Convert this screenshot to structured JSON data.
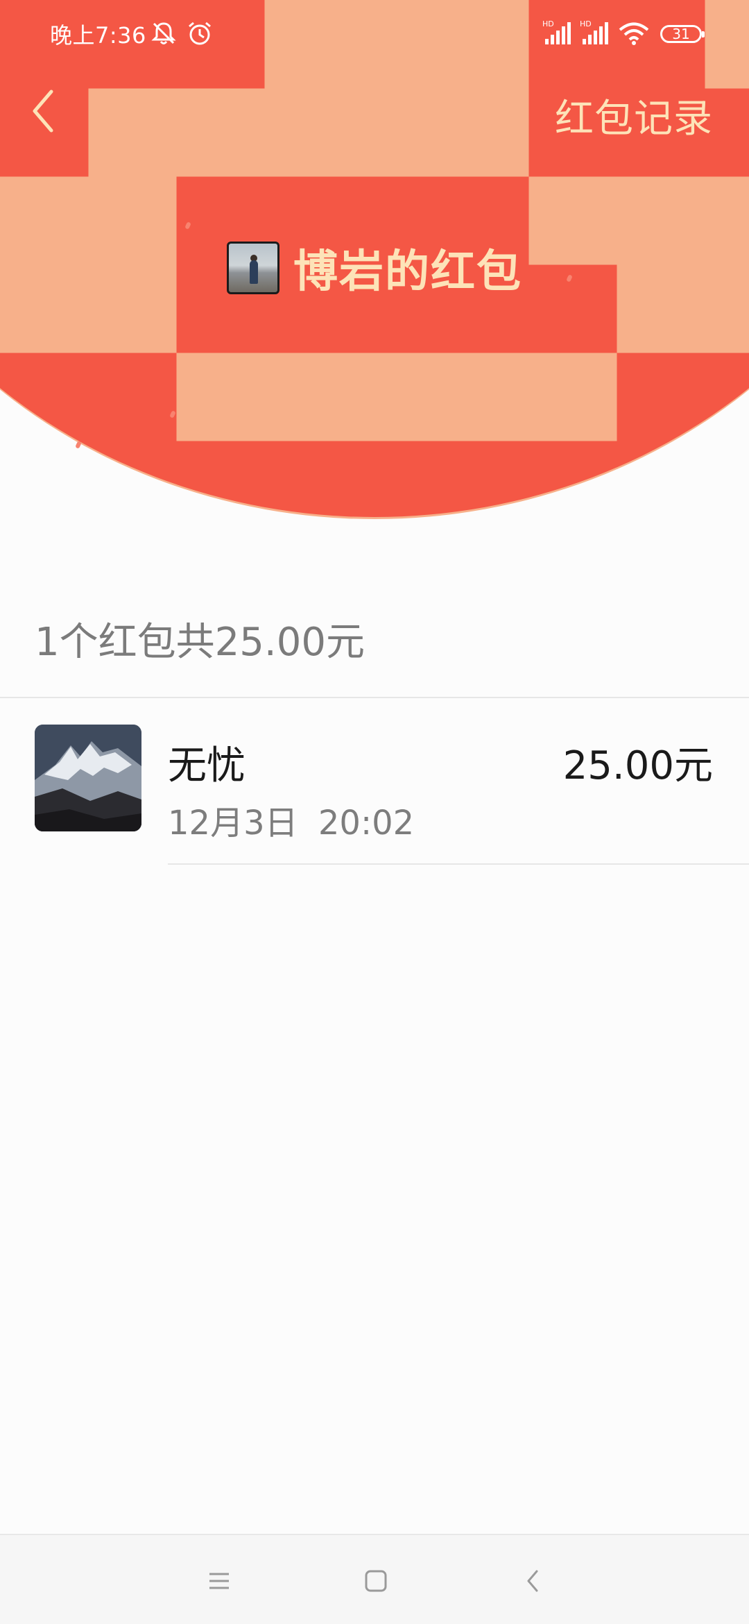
{
  "status_bar": {
    "time": "晚上7:36",
    "battery": "31",
    "icons": [
      "mute-bell-icon",
      "alarm-icon",
      "signal-hd-icon",
      "signal-hd-icon",
      "wifi-icon",
      "battery-icon"
    ]
  },
  "nav": {
    "back_icon": "back-chevron-icon",
    "records_label": "红包记录"
  },
  "header": {
    "title": "博岩的红包"
  },
  "summary": {
    "text": "1个红包共25.00元"
  },
  "records": [
    {
      "name": "无忧",
      "time": "12月3日 20:02",
      "amount": "25.00元"
    }
  ],
  "system_nav": {
    "icons": [
      "menu-icon",
      "home-icon",
      "back-icon"
    ]
  },
  "colors": {
    "header_red": "#f45745",
    "gold_text": "#fde3b8",
    "background": "#fcfcfc"
  }
}
